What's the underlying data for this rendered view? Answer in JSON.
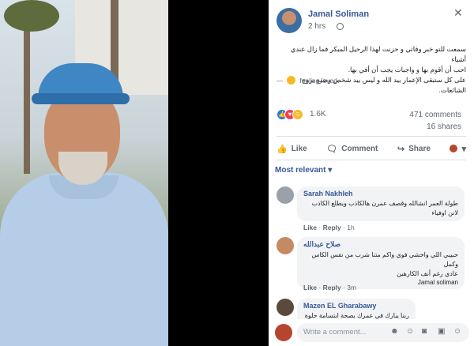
{
  "post": {
    "author": "Jamal Soliman",
    "time": "2 hrs",
    "text_lines": [
      "سمعت للتو خبر وفاتي و حزنت لهذا الرحيل المبكر فما زال عندي أشياء",
      "احب أن أقوم بها و واجبات يجب أن أفي بها.",
      "على كل ستبقى الإعمار بيد الله و ليس بيد شخص وضيع يروج الشائعات."
    ],
    "feeling_dash": "—",
    "feeling_text": "feeling loved.",
    "reaction_count": "1.6K",
    "comments_count": "471 comments",
    "shares_count": "16 shares"
  },
  "actions": {
    "like": "Like",
    "comment": "Comment",
    "share": "Share"
  },
  "sort_label": "Most relevant",
  "comments": [
    {
      "name": "Sarah Nakhleh",
      "text_lines": [
        "طولة العمر انشالله وقصف عمرن هالكاذب ويطلع الكاذب",
        "لانن اوفياء"
      ],
      "meta": [
        "Like",
        "Reply",
        "1h"
      ]
    },
    {
      "name": "صلاح عبدالله",
      "text_lines": [
        "حبيبي اللي واخشي فوي واكم متنا شرب من نفس الكاس وكمل",
        "عادي رغم أنف الكارهين"
      ],
      "mention": "Jamal soliman",
      "meta": [
        "Like",
        "Reply",
        "3m"
      ]
    },
    {
      "name": "Mazen EL Gharabawy",
      "text_lines": [
        "ربنا يبارك في عمرك بصحة ابتسامة حلوة و رحمة لجميع"
      ]
    }
  ],
  "composer": {
    "placeholder": "Write a comment..."
  },
  "icons": {
    "close": "close-icon",
    "globe": "globe-icon",
    "like": "thumbs-up-icon",
    "comment": "speech-bubble-icon",
    "share": "share-arrow-icon"
  }
}
